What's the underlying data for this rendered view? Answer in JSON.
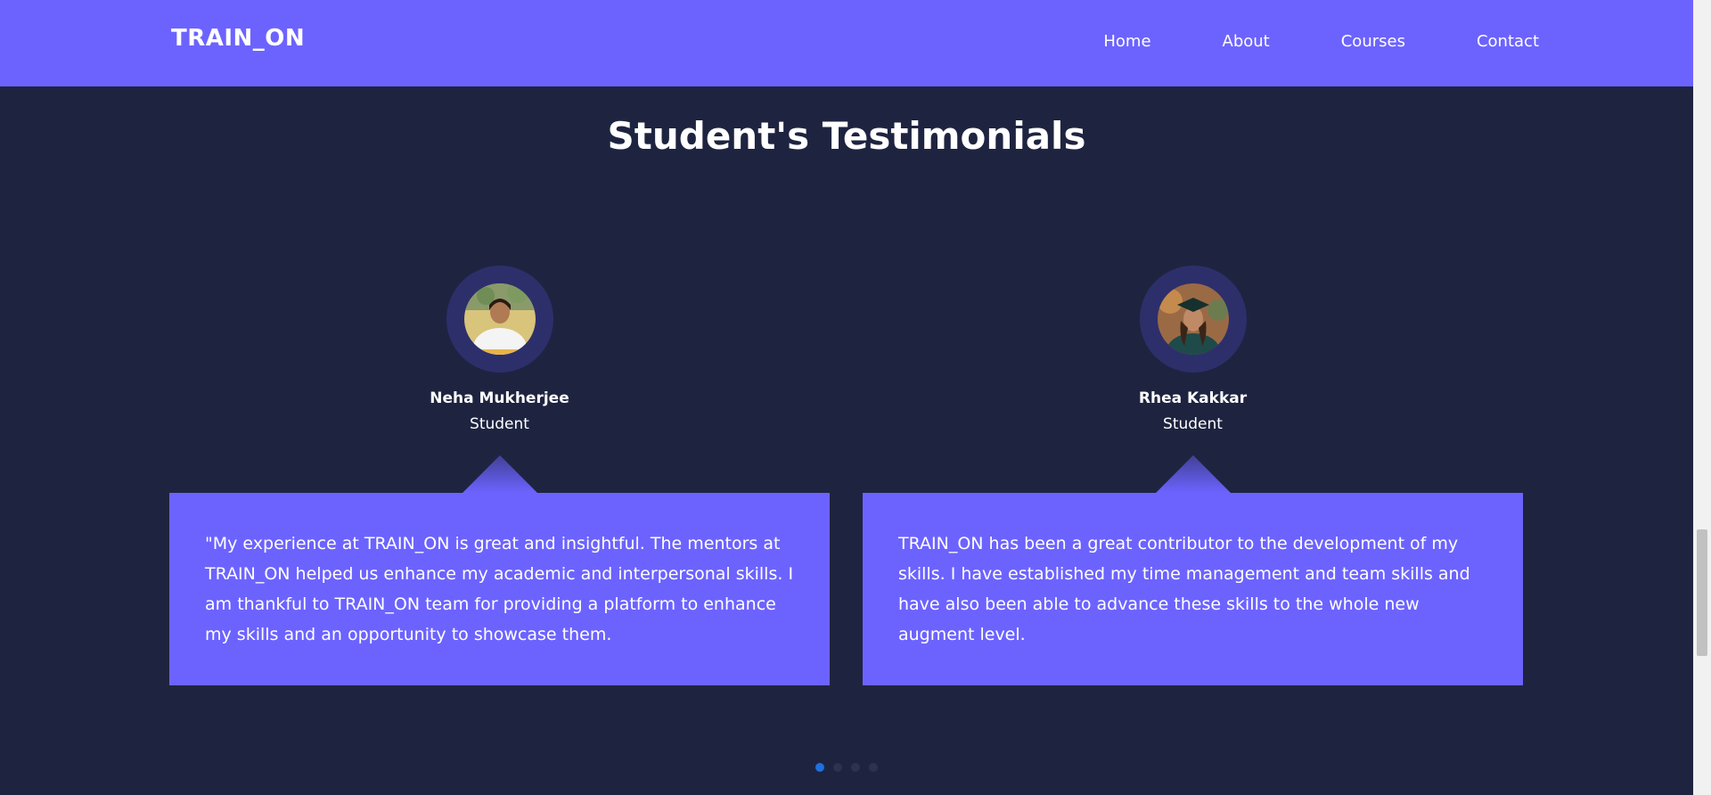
{
  "header": {
    "brand": "TRAIN_ON",
    "nav": [
      "Home",
      "About",
      "Courses",
      "Contact"
    ]
  },
  "section": {
    "title": "Student's Testimonials"
  },
  "testimonials": [
    {
      "name": "Neha Mukherjee",
      "role": "Student",
      "quote": "\"My experience at TRAIN_ON is great and insightful. The mentors at TRAIN_ON helped us enhance my academic and interpersonal skills. I am thankful to TRAIN_ON team for providing a platform to enhance my skills and an opportunity to showcase them."
    },
    {
      "name": "Rhea Kakkar",
      "role": "Student",
      "quote": "TRAIN_ON has been a great contributor to the development of my skills. I have established my time management and team skills and have also been able to advance these skills to the whole new augment level."
    }
  ],
  "carousel": {
    "dot_count": 4,
    "active_index": 0
  },
  "colors": {
    "accent": "#6c63ff",
    "background": "#1e2440",
    "active_dot": "#1e6fe0"
  }
}
